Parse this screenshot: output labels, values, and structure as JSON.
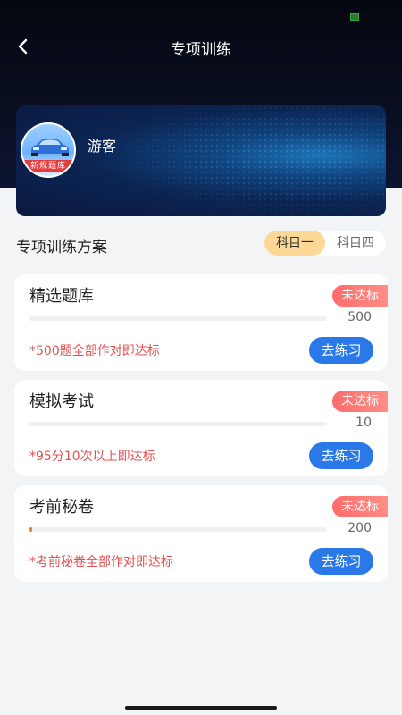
{
  "header": {
    "title": "专项训练"
  },
  "user": {
    "name": "游客",
    "avatar_tag": "新规题库"
  },
  "plan": {
    "title": "专项训练方案",
    "subjects": [
      {
        "label": "科目一",
        "active": true
      },
      {
        "label": "科目四",
        "active": false
      }
    ]
  },
  "cards": [
    {
      "title": "精选题库",
      "status": "未达标",
      "count": "500",
      "progress": 0,
      "requirement": "*500题全部作对即达标",
      "button": "去练习"
    },
    {
      "title": "模拟考试",
      "status": "未达标",
      "count": "10",
      "progress": 0,
      "requirement": "*95分10次以上即达标",
      "button": "去练习"
    },
    {
      "title": "考前秘卷",
      "status": "未达标",
      "count": "200",
      "progress": 0.005,
      "requirement": "*考前秘卷全部作对即达标",
      "button": "去练习"
    }
  ],
  "colors": {
    "accent": "#2b78e8",
    "warning": "#ff6b6b",
    "subject_active": "#fbd896",
    "progress": "#ff7a1a"
  }
}
